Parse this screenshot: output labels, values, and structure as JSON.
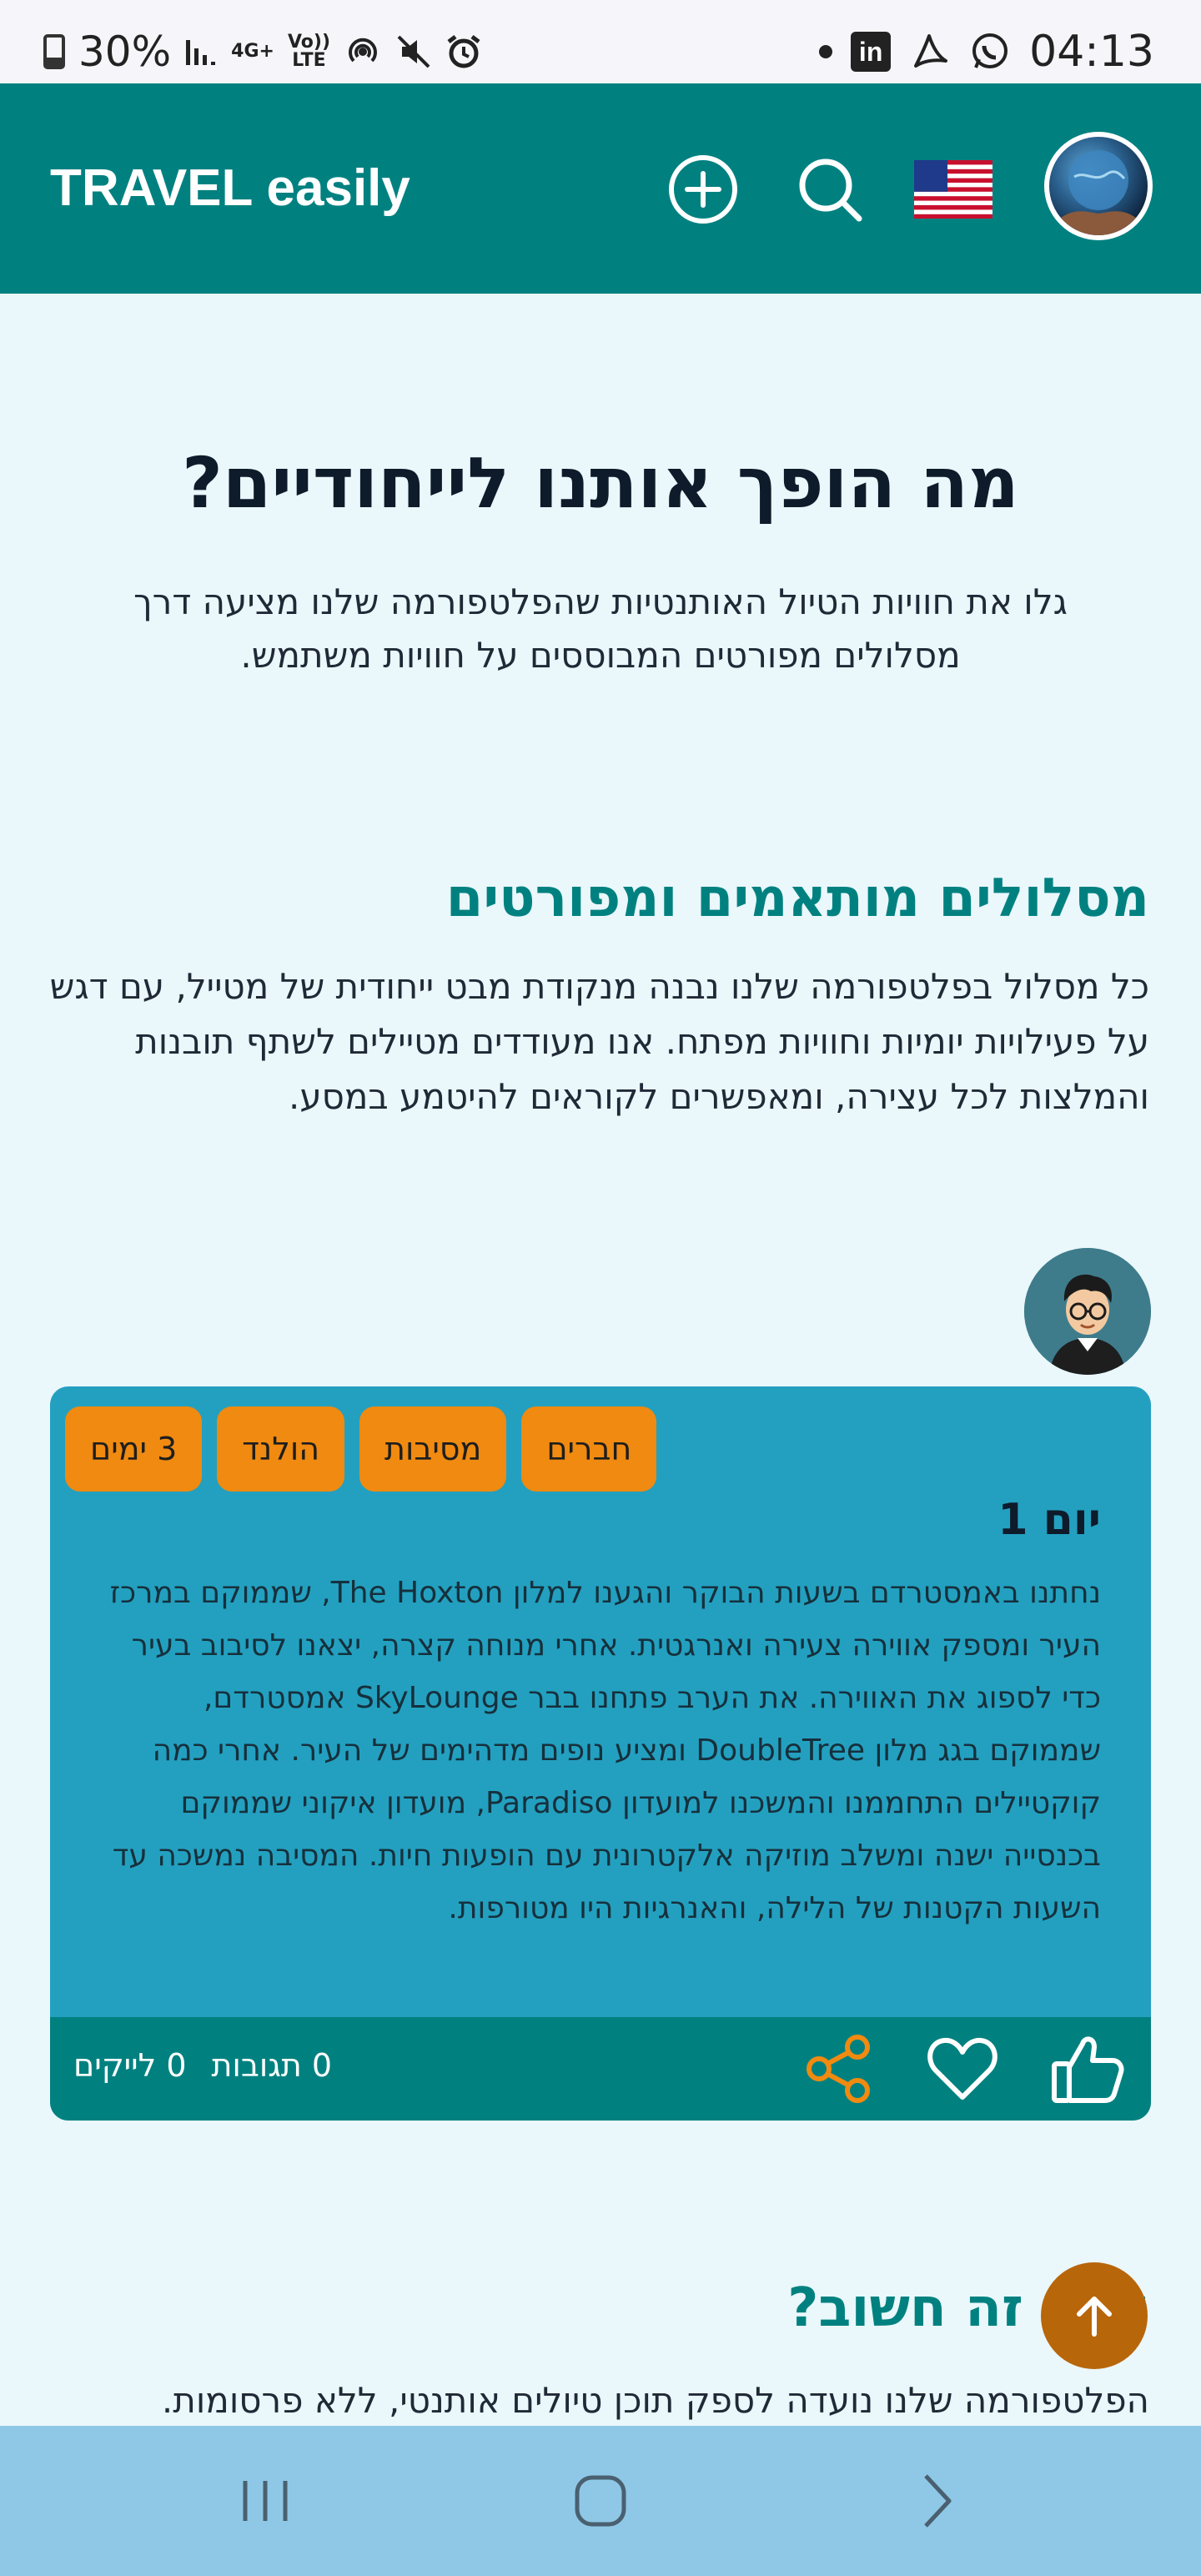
{
  "status_bar": {
    "battery_percent": "30%",
    "net_4g": "4G+",
    "volte_top": "Vo))",
    "volte_bottom": "LTE",
    "linkedin": "in",
    "time": "04:13"
  },
  "header": {
    "brand": "TRAVEL easily",
    "icons": [
      "add-circle-icon",
      "search-icon",
      "us-flag-icon",
      "profile-avatar"
    ]
  },
  "hero": {
    "title": "מה הופך אותנו לייחודיים?",
    "subtitle": "גלו את חוויות הטיול האותנטיות שהפלטפורמה שלנו מציעה דרך מסלולים מפורטים המבוססים על חוויות משתמש."
  },
  "section": {
    "title": "מסלולים מותאמים ומפורטים",
    "text": "כל מסלול בפלטפורמה שלנו נבנה מנקודת מבט ייחודית של מטייל, עם דגש על פעילויות יומיות וחוויות מפתח. אנו מעודדים מטיילים לשתף תובנות והמלצות לכל עצירה, ומאפשרים לקוראים להיטמע במסע."
  },
  "card": {
    "tags": [
      "3 ימים",
      "הולנד",
      "מסיבות",
      "חברים"
    ],
    "day_title": "יום 1",
    "day_text": "נחתנו באמסטרדם בשעות הבוקר והגענו למלון The Hoxton, שממוקם במרכז העיר ומספק אווירה צעירה ואנרגטית. אחרי מנוחה קצרה, יצאנו לסיבוב בעיר כדי לספוג את האווירה. את הערב פתחנו בבר SkyLounge אמסטרדם, שממוקם בגג מלון DoubleTree ומציע נופים מדהימים של העיר. אחרי כמה קוקטיילים התחממנו והמשכנו למועדון Paradiso, מועדון איקוני שממוקם בכנסייה ישנה ומשלב מוזיקה אלקטרונית עם הופעות חיות. המסיבה נמשכה עד השעות הקטנות של הלילה, והאנרגיות היו מטורפות.",
    "likes": "0 לייקים",
    "comments": "0 תגובות"
  },
  "section2": {
    "title": "למה זה חשוב?",
    "text": "הפלטפורמה שלנו נועדה לספק תוכן טיולים אותנטי, ללא פרסומות."
  },
  "colors": {
    "header": "#008180",
    "page_bg": "#EAF7FB",
    "card_bg": "#23A0C0",
    "tag_bg": "#F08A10",
    "share_icon": "#F08A10",
    "fab": "#B8660A",
    "navbar": "#8FC8E6"
  }
}
